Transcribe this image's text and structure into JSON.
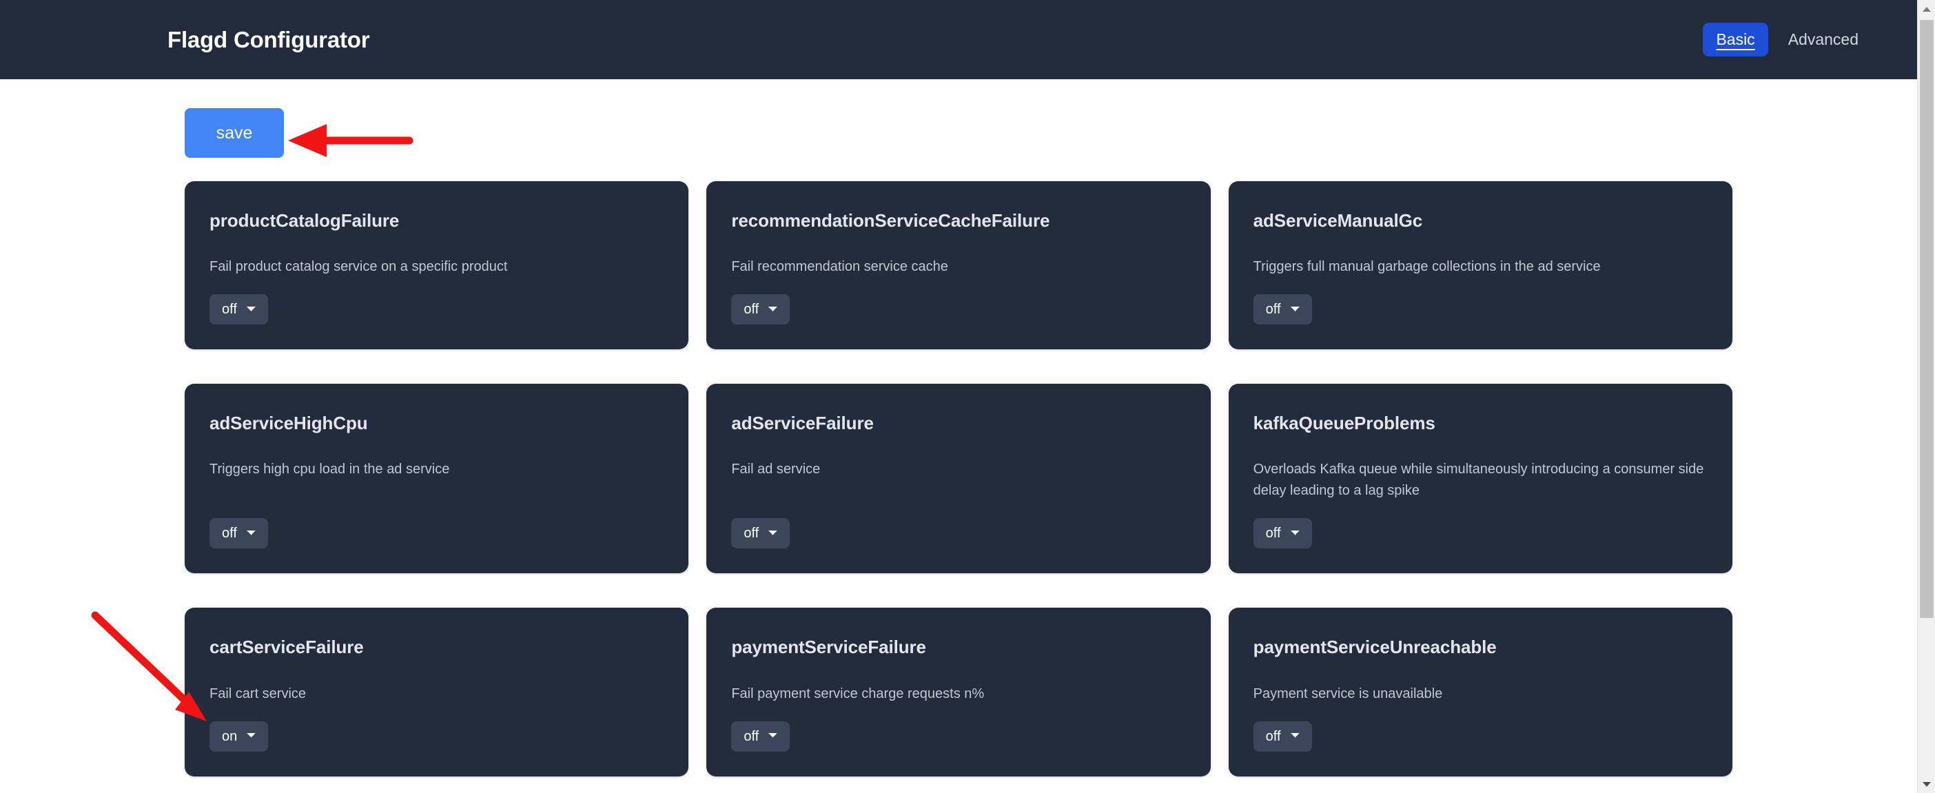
{
  "header": {
    "title": "Flagd Configurator",
    "tabs": [
      {
        "label": "Basic",
        "active": true
      },
      {
        "label": "Advanced",
        "active": false
      }
    ]
  },
  "toolbar": {
    "save_label": "save"
  },
  "colors": {
    "header_bg": "#212b3b",
    "card_bg": "#222c3c",
    "page_bg": "#ffffff",
    "accent_blue": "#1d4ed8",
    "save_blue": "#4285f4",
    "select_bg": "#3b465a",
    "annotation_red": "#f01414"
  },
  "select_options": [
    "on",
    "off"
  ],
  "flags": [
    {
      "name": "productCatalogFailure",
      "description": "Fail product catalog service on a specific product",
      "value": "off"
    },
    {
      "name": "recommendationServiceCacheFailure",
      "description": "Fail recommendation service cache",
      "value": "off"
    },
    {
      "name": "adServiceManualGc",
      "description": "Triggers full manual garbage collections in the ad service",
      "value": "off"
    },
    {
      "name": "adServiceHighCpu",
      "description": "Triggers high cpu load in the ad service",
      "value": "off"
    },
    {
      "name": "adServiceFailure",
      "description": "Fail ad service",
      "value": "off"
    },
    {
      "name": "kafkaQueueProblems",
      "description": "Overloads Kafka queue while simultaneously introducing a consumer side delay leading to a lag spike",
      "value": "off"
    },
    {
      "name": "cartServiceFailure",
      "description": "Fail cart service",
      "value": "on"
    },
    {
      "name": "paymentServiceFailure",
      "description": "Fail payment service charge requests n%",
      "value": "off"
    },
    {
      "name": "paymentServiceUnreachable",
      "description": "Payment service is unavailable",
      "value": "off"
    }
  ],
  "annotations": [
    {
      "target": "save-button",
      "shape": "arrow-left"
    },
    {
      "target": "cart-service-failure-select",
      "shape": "arrow-down-right"
    }
  ]
}
